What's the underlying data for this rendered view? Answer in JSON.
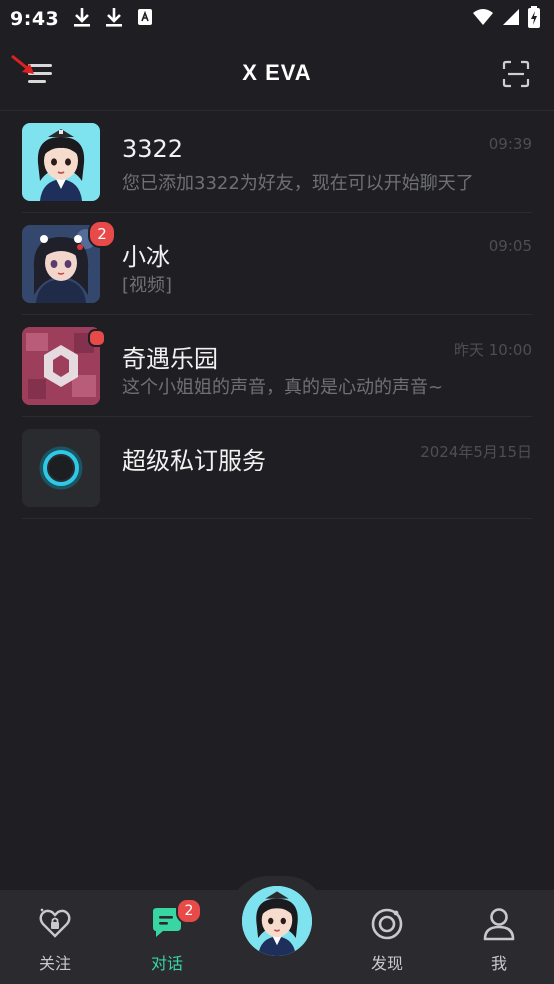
{
  "statusbar": {
    "time": "9:43"
  },
  "header": {
    "title": "X EVA"
  },
  "chats": [
    {
      "name": "3322",
      "message": "您已添加3322为好友，现在可以开始聊天了",
      "time": "09:39",
      "badge": ""
    },
    {
      "name": "小冰",
      "message": "[视频]",
      "time": "09:05",
      "badge": "2"
    },
    {
      "name": "奇遇乐园",
      "message": "这个小姐姐的声音，真的是心动的声音~",
      "time": "昨天 10:00",
      "badge": ""
    },
    {
      "name": "超级私订服务",
      "message": "",
      "time": "2024年5月15日",
      "badge": ""
    }
  ],
  "nav": {
    "follow_label": "关注",
    "chat_label": "对话",
    "chat_badge": "2",
    "discover_label": "发现",
    "me_label": "我"
  },
  "colors": {
    "accent": "#38d6a0",
    "badge": "#e84a4a",
    "background": "#1f1f23"
  }
}
